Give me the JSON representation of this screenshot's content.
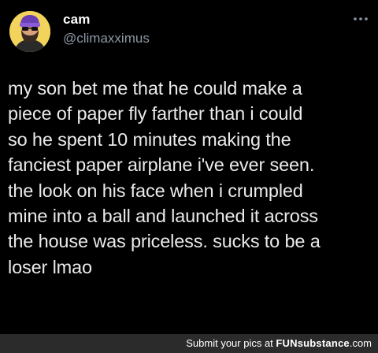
{
  "tweet": {
    "display_name": "cam",
    "handle": "@climaxximus",
    "more_icon": "more-horizontal-icon",
    "text_lines": [
      "my son bet me that he could make a",
      "piece of paper fly farther than i could",
      "so he spent 10 minutes making the",
      "fanciest paper airplane i've ever seen.",
      "the look on his face when i crumpled",
      "mine into a ball and launched it across",
      "the house was priceless. sucks to be a",
      "loser lmao"
    ]
  },
  "footer": {
    "prefix": "Submit your pics at ",
    "brand": "FUNsubstance",
    "suffix": ".com"
  },
  "colors": {
    "background": "#000000",
    "text": "#e7e9ea",
    "secondary": "#8b98a5",
    "footer_bg": "#2b2b2b"
  }
}
